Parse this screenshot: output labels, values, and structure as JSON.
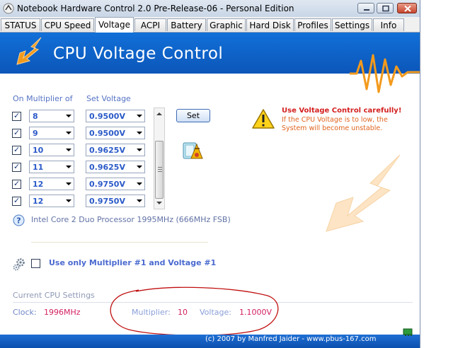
{
  "window": {
    "title": "Notebook Hardware Control 2.0 Pre-Release-06  -  Personal Edition"
  },
  "tabs": [
    {
      "label": "STATUS"
    },
    {
      "label": "CPU Speed"
    },
    {
      "label": "Voltage",
      "active": true
    },
    {
      "label": "ACPI"
    },
    {
      "label": "Battery"
    },
    {
      "label": "Graphic"
    },
    {
      "label": "Hard Disk"
    },
    {
      "label": "Profiles"
    },
    {
      "label": "Settings"
    },
    {
      "label": "Info"
    }
  ],
  "banner": {
    "title": "CPU Voltage Control"
  },
  "voltage_table": {
    "header_multiplier": "On Multiplier of",
    "header_voltage": "Set Voltage",
    "rows": [
      {
        "checked": true,
        "multiplier": "8",
        "voltage": "0.9500V"
      },
      {
        "checked": true,
        "multiplier": "9",
        "voltage": "0.9500V"
      },
      {
        "checked": true,
        "multiplier": "10",
        "voltage": "0.9625V"
      },
      {
        "checked": true,
        "multiplier": "11",
        "voltage": "0.9625V"
      },
      {
        "checked": true,
        "multiplier": "12",
        "voltage": "0.9750V"
      },
      {
        "checked": true,
        "multiplier": "12",
        "voltage": "0.9750V"
      }
    ]
  },
  "set_button": {
    "label": "Set"
  },
  "warning": {
    "title": "Use Voltage Control carefully!",
    "text": "If the CPU Voltage is to low, the System will become unstable."
  },
  "cpu_info": "Intel Core 2 Duo Processor 1995MHz (666MHz FSB)",
  "option": {
    "label": "Use only Multiplier #1 and Voltage #1",
    "checked": false
  },
  "current": {
    "title": "Current CPU Settings",
    "clock_label": "Clock:",
    "clock_value": "1996MHz",
    "multiplier_label": "Multiplier:",
    "multiplier_value": "10",
    "voltage_label": "Voltage:",
    "voltage_value": "1.1000V"
  },
  "footer": {
    "text": "(c) 2007 by Manfred Jaider - www.pbus-167.com"
  },
  "colors": {
    "banner_blue": "#0c55b8",
    "accent_orange": "#f39a1c",
    "warning_red": "#d42020",
    "value_red": "#d32060",
    "annotation_red": "#c01010"
  }
}
